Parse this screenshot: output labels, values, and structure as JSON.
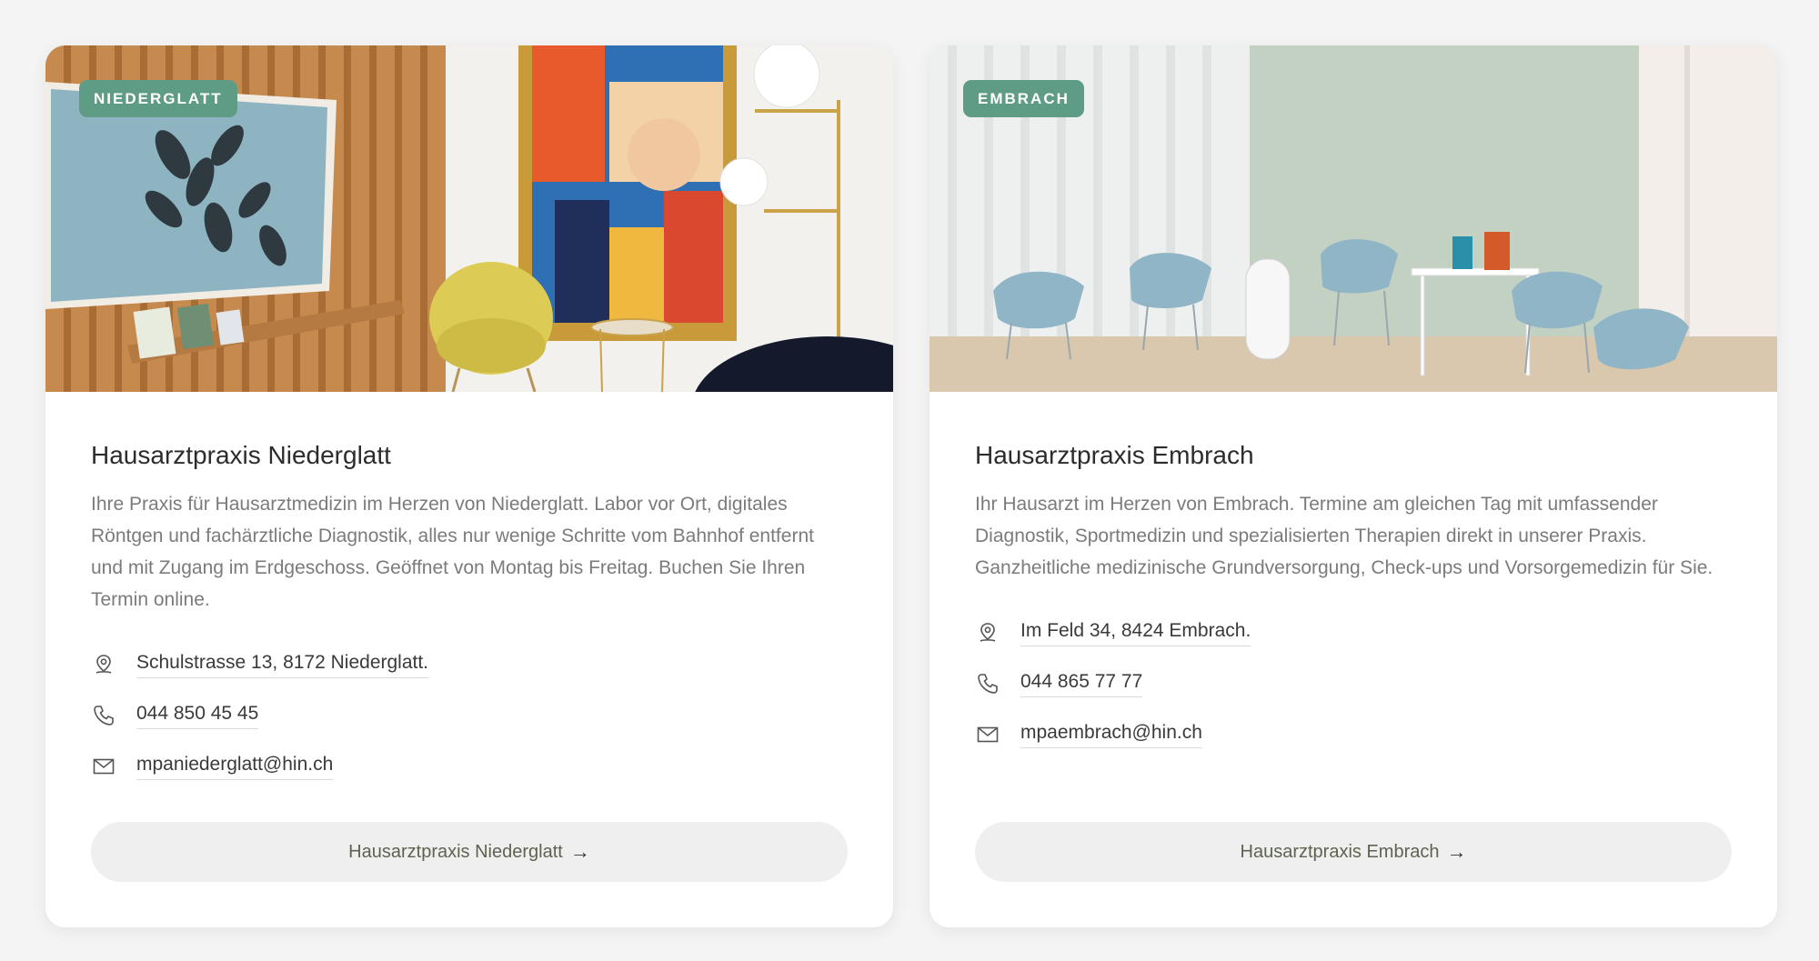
{
  "cards": [
    {
      "badge": "NIEDERGLATT",
      "title": "Hausarztpraxis Niederglatt",
      "description": "Ihre Praxis für Hausarztmedizin im Herzen von Niederglatt. Labor vor Ort, digitales Röntgen und fachärztliche Diagnostik, alles nur wenige Schritte vom Bahnhof entfernt und mit Zugang im Erdgeschoss. Geöffnet von Montag bis Freitag. Buchen Sie Ihren Termin online.",
      "address": "Schulstrasse 13, 8172 Niederglatt.",
      "phone": "044 850 45 45",
      "email": "mpaniederglatt@hin.ch",
      "cta_label": "Hausarztpraxis Niederglatt",
      "cta_arrow": "→"
    },
    {
      "badge": "EMBRACH",
      "title": "Hausarztpraxis Embrach",
      "description": "Ihr Hausarzt im Herzen von Embrach. Termine am gleichen Tag mit umfassender Diagnostik, Sportmedizin und spezialisierten Therapien direkt in unserer Praxis. Ganzheitliche medizinische Grundversorgung, Check-ups und Vorsorgemedizin für Sie.",
      "address": "Im Feld 34, 8424 Embrach.",
      "phone": "044 865 77 77",
      "email": "mpaembrach@hin.ch",
      "cta_label": "Hausarztpraxis Embrach",
      "cta_arrow": "→"
    }
  ],
  "colors": {
    "badge_bg": "#5f9c85",
    "page_bg": "#f4f4f4",
    "button_bg": "#efefef"
  },
  "icons": {
    "address": "map-pin-icon",
    "phone": "phone-icon",
    "email": "mail-icon"
  }
}
